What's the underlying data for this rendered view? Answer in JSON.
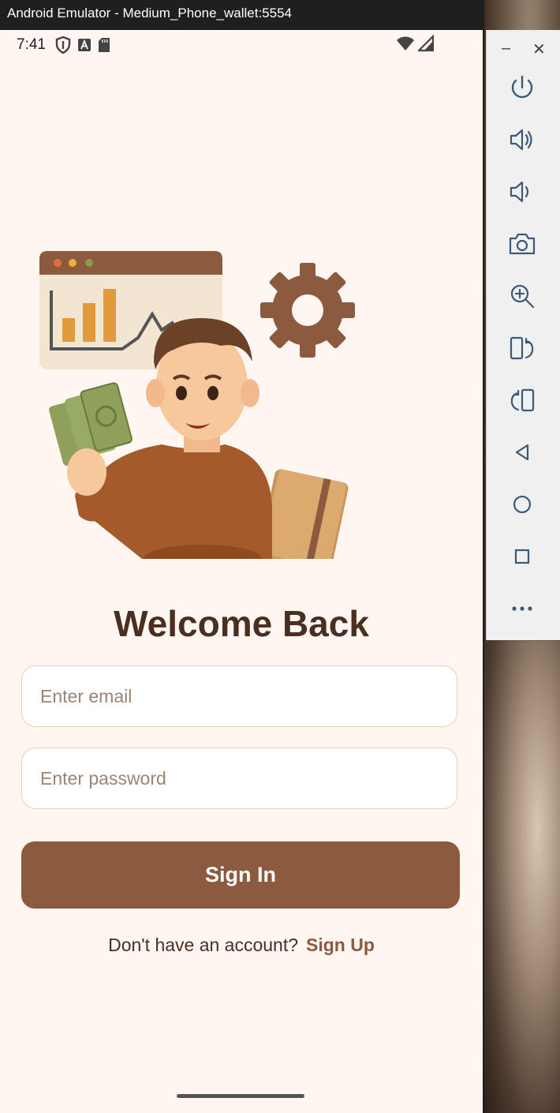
{
  "window": {
    "title": "Android Emulator - Medium_Phone_wallet:5554"
  },
  "statusbar": {
    "time": "7:41"
  },
  "login": {
    "title": "Welcome Back",
    "email_placeholder": "Enter email",
    "password_placeholder": "Enter password",
    "signin_label": "Sign In",
    "signup_prompt": "Don't have an account?",
    "signup_link": "Sign Up"
  },
  "colors": {
    "background": "#fff6f2",
    "primary": "#8b5a3f",
    "heading": "#4a2e1f",
    "field_border": "#e3d3b5"
  },
  "toolbar": {
    "items": [
      "power-icon",
      "volume-up-icon",
      "volume-down-icon",
      "camera-icon",
      "zoom-icon",
      "rotate-left-icon",
      "rotate-right-icon",
      "back-icon",
      "home-icon",
      "overview-icon",
      "more-icon"
    ]
  }
}
